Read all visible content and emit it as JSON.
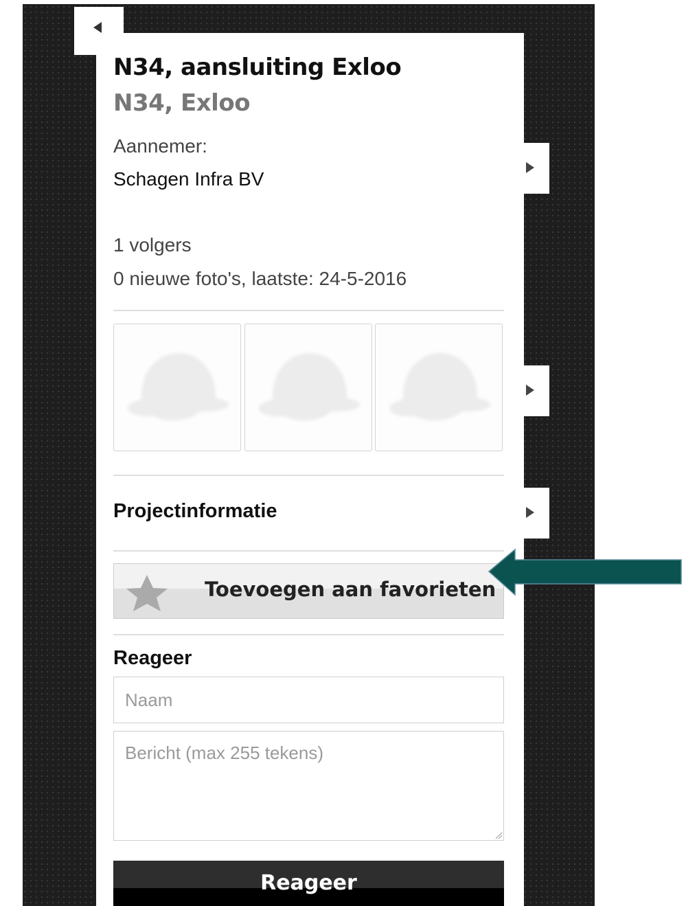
{
  "project": {
    "title": "N34, aansluiting Exloo",
    "location": "N34, Exloo",
    "contractor_label": "Aannemer:",
    "contractor": "Schagen Infra BV",
    "followers": "1 volgers",
    "photos_info": "0 nieuwe foto's, laatste: 24-5-2016"
  },
  "photos": {
    "placeholder_icon": "helmet-placeholder-icon",
    "count": 3
  },
  "project_info": {
    "label": "Projectinformatie"
  },
  "favorites": {
    "label": "Toevoegen aan favorieten",
    "icon": "star-icon"
  },
  "comment_form": {
    "title": "Reageer",
    "name_placeholder": "Naam",
    "message_placeholder": "Bericht (max 255 tekens)",
    "submit_label": "Reageer"
  },
  "colors": {
    "background": "#1e1e1e",
    "arrow": "#0b5350",
    "submit_button": "#2e2e2e"
  }
}
